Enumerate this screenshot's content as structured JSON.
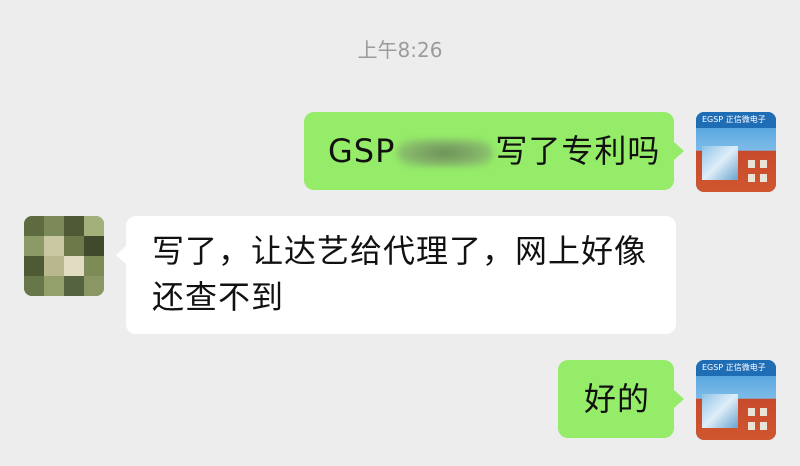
{
  "chat": {
    "timestamp": "上午8:26",
    "messages": [
      {
        "sender": "me",
        "text_prefix": "GSP",
        "text_suffix": "写了专利吗"
      },
      {
        "sender": "other",
        "line1": "写了，让达艺给代理了，网上好像",
        "line2": "还查不到"
      },
      {
        "sender": "me",
        "text": "好的"
      }
    ],
    "avatars": {
      "me_label": "EGSP 正信微电子"
    }
  },
  "colors": {
    "background": "#ededed",
    "my_bubble": "#95ec69",
    "other_bubble": "#ffffff",
    "timestamp": "#9b9b9b"
  }
}
